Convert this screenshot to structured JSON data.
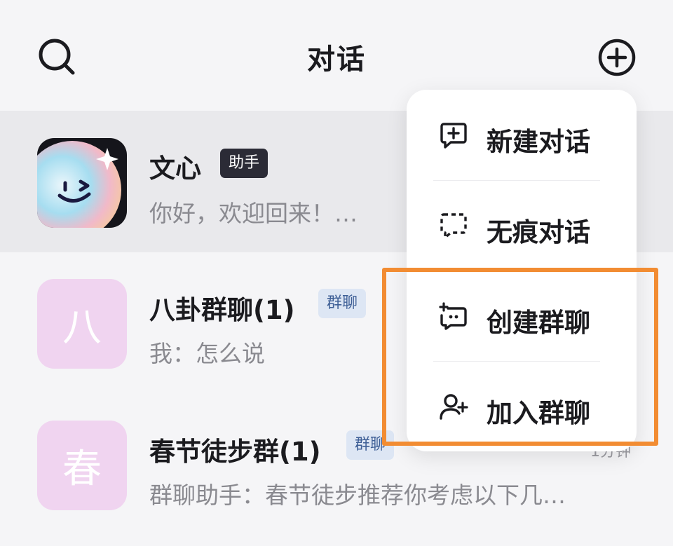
{
  "header": {
    "title": "对话"
  },
  "conversations": [
    {
      "name": "文心",
      "badge": "助手",
      "preview": "你好，欢迎回来！…",
      "avatar_icon": "wenxin-smile-avatar-icon"
    },
    {
      "name": "八卦群聊(1)",
      "badge": "群聊",
      "preview": "我：怎么说",
      "avatar_letter": "八"
    },
    {
      "name": "春节徒步群(1)",
      "badge": "群聊",
      "preview": "群聊助手：春节徒步推荐你考虑以下几…",
      "avatar_letter": "春",
      "time": "1分钟"
    }
  ],
  "menu": {
    "items": [
      {
        "label": "新建对话",
        "icon": "new-chat-icon"
      },
      {
        "label": "无痕对话",
        "icon": "incognito-chat-icon"
      },
      {
        "label": "创建群聊",
        "icon": "create-group-icon"
      },
      {
        "label": "加入群聊",
        "icon": "join-group-icon"
      }
    ]
  },
  "colors": {
    "page_bg": "#f5f5f7",
    "highlight_row": "#e9e9ec",
    "avatar_pink": "#f0d4f0",
    "badge_dark": "#2b2b36",
    "badge_blue_bg": "#dde6f4",
    "badge_blue_text": "#3e5f96",
    "annotation_orange": "#f28c32"
  }
}
